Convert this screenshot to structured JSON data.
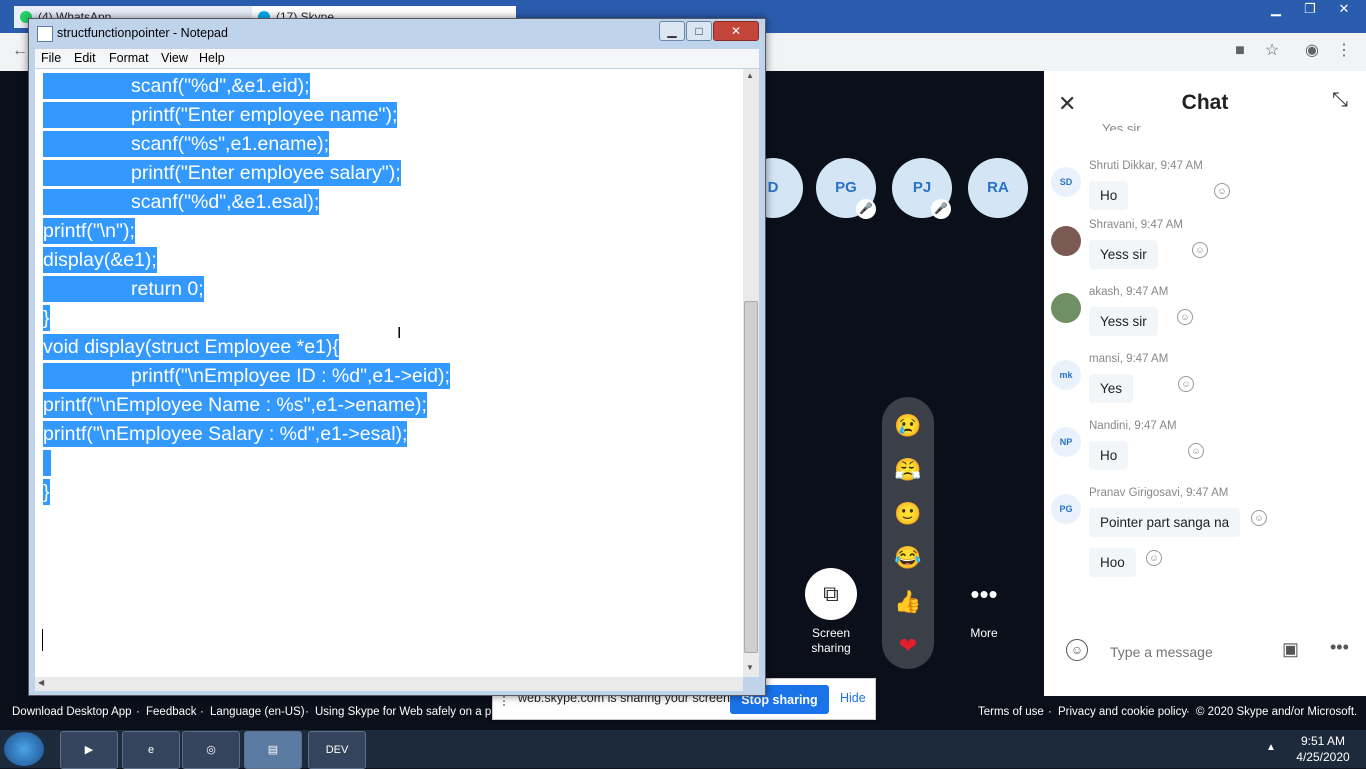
{
  "browser": {
    "tabs": [
      "(4) WhatsApp",
      "(17) Skype"
    ],
    "new_tab": "+",
    "window_controls": {
      "minimize": "▁",
      "restore": "❐",
      "close": "✕"
    },
    "toolbar_icons": [
      "back-icon",
      "camera-icon",
      "star-icon",
      "account-icon",
      "menu-icon"
    ]
  },
  "call": {
    "participants": [
      {
        "initials": "D",
        "muted": false
      },
      {
        "initials": "PG",
        "muted": true
      },
      {
        "initials": "PJ",
        "muted": true
      },
      {
        "initials": "RA",
        "muted": false
      }
    ],
    "controls": {
      "screen_sharing": "Screen\nsharing",
      "more": "More"
    },
    "reactions": [
      "😢",
      "😤",
      "🙂",
      "😂",
      "👍",
      "❤"
    ]
  },
  "chat": {
    "title": "Chat",
    "partial_top": "Yes sir",
    "messages": [
      {
        "initials": "SD",
        "author": "Shruti Dikkar",
        "time": "9:47 AM",
        "text": "Ho"
      },
      {
        "initials": "",
        "author": "Shravani",
        "time": "9:47 AM",
        "text": "Yess sir"
      },
      {
        "initials": "",
        "author": "akash",
        "time": "9:47 AM",
        "text": "Yess sir"
      },
      {
        "initials": "mk",
        "author": "mansi",
        "time": "9:47 AM",
        "text": "Yes"
      },
      {
        "initials": "NP",
        "author": "Nandini",
        "time": "9:47 AM",
        "text": "Ho"
      },
      {
        "initials": "PG",
        "author": "Pranav Girigosavi",
        "time": "9:47 AM",
        "text": "Pointer part sanga na",
        "extra": "Hoo"
      }
    ],
    "input_placeholder": "Type a message"
  },
  "share_bar": {
    "text": "web.skype.com is sharing your screen.",
    "stop_label": "Stop sharing",
    "hide_label": "Hide"
  },
  "footer": {
    "left": [
      "Download Desktop App",
      "·",
      "Feedback",
      "·",
      "Language (en-US)",
      "·",
      "Using Skype for Web safely on a pub"
    ],
    "right": [
      "Terms of use",
      "·",
      "Privacy and cookie policy",
      "·",
      "© 2020 Skype and/or Microsoft."
    ]
  },
  "taskbar": {
    "time": "9:51 AM",
    "date": "4/25/2020",
    "apps": [
      "start",
      "media-player",
      "internet-explorer",
      "chrome",
      "notepad",
      "DEV"
    ]
  },
  "notepad": {
    "title": "structfunctionpointer - Notepad",
    "menu": [
      "File",
      "Edit",
      "Format",
      "View",
      "Help"
    ],
    "lines": [
      "scanf(\"%d\",&e1.eid);",
      "printf(\"Enter employee name\");",
      "scanf(\"%s\",e1.ename);",
      "printf(\"Enter employee salary\");",
      "scanf(\"%d\",&e1.esal);",
      "printf(\"\\n\");",
      "display(&e1);",
      "return 0;",
      "}",
      "void display(struct Employee *e1){",
      "printf(\"\\nEmployee ID : %d\",e1->eid);",
      "printf(\"\\nEmployee Name : %s\",e1->ename);",
      "printf(\"\\nEmployee Salary : %d\",e1->esal);",
      "",
      "}"
    ]
  },
  "colors": {
    "selection": "#3399ff",
    "skype_blue": "#1a73e8",
    "call_bg": "#0b0f1a"
  }
}
